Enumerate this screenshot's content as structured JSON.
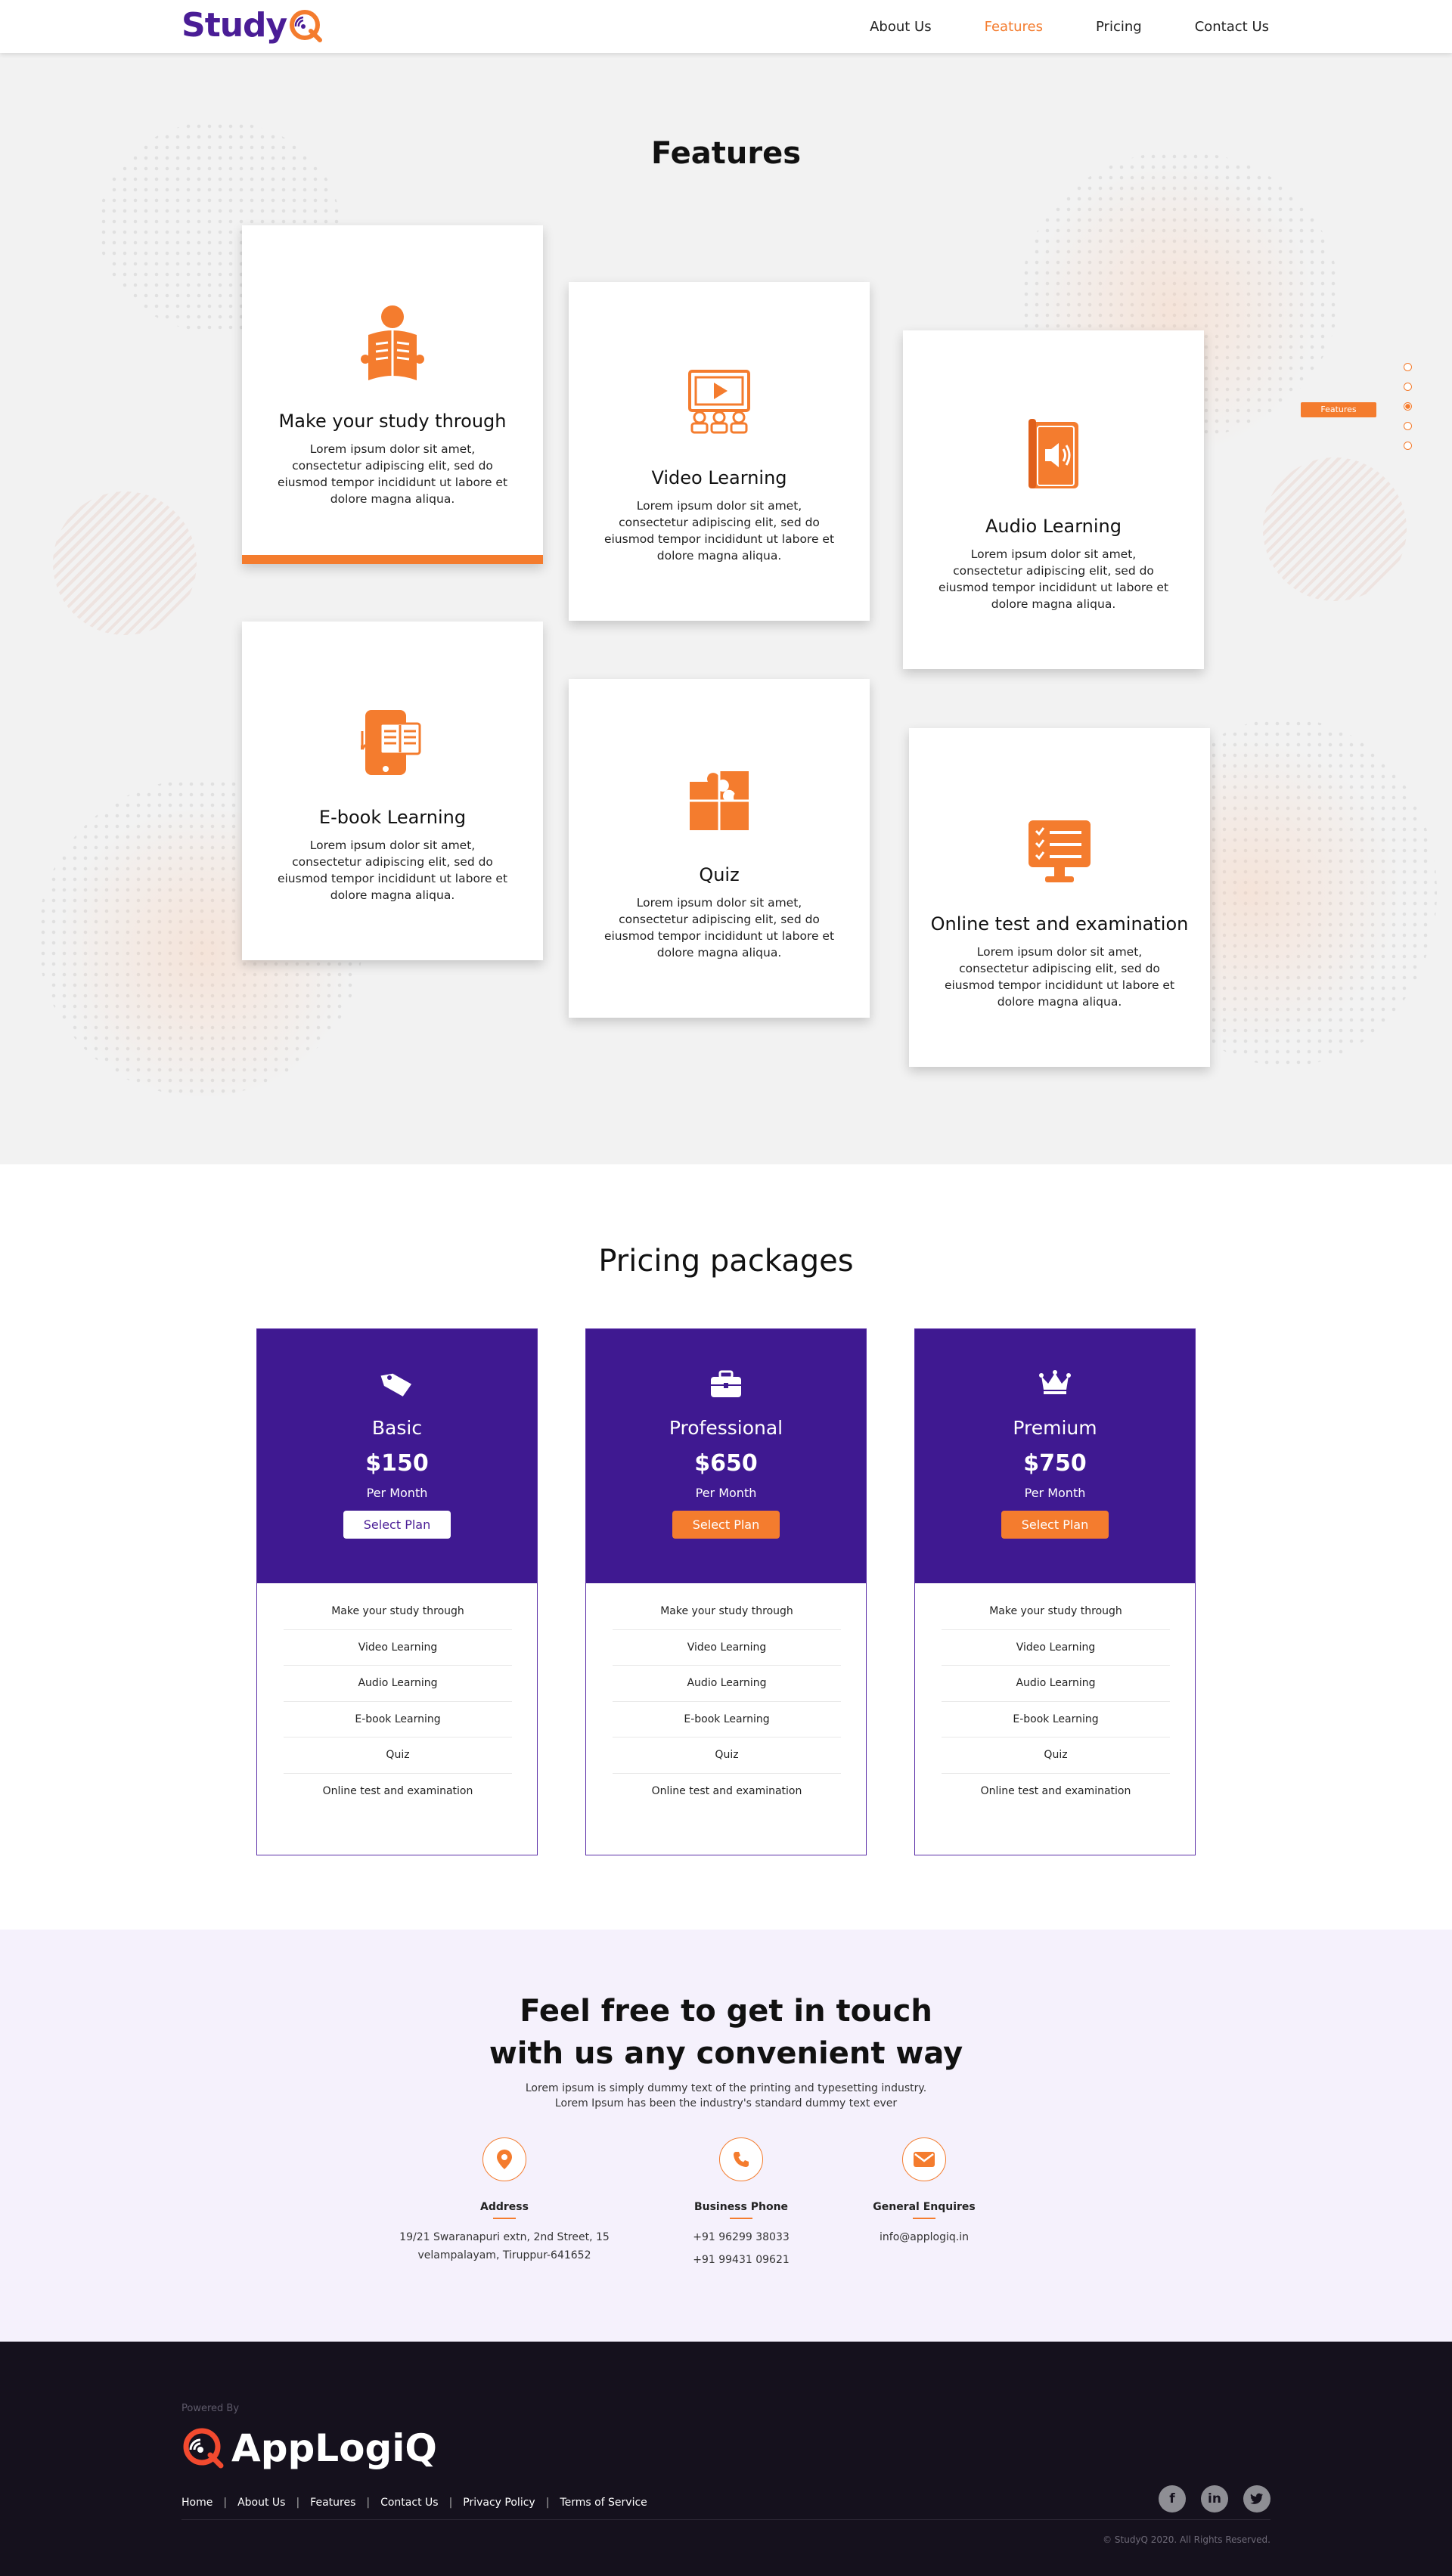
{
  "header": {
    "logo_text": "Study",
    "nav": [
      "About Us",
      "Features",
      "Pricing",
      "Contact Us"
    ],
    "active_nav": "Features"
  },
  "features": {
    "title": "Features",
    "side_nav_label": "Features",
    "cards": [
      {
        "title": "Make your study through",
        "icon": "reading-person-icon",
        "desc": "Lorem ipsum dolor sit amet, consectetur adipiscing elit, sed do eiusmod tempor incididunt ut labore et dolore magna aliqua."
      },
      {
        "title": "Video Learning",
        "icon": "video-screen-icon",
        "desc": "Lorem ipsum dolor sit amet, consectetur adipiscing elit, sed do eiusmod tempor incididunt ut labore et dolore magna aliqua."
      },
      {
        "title": "Audio Learning",
        "icon": "audio-book-icon",
        "desc": "Lorem ipsum dolor sit amet, consectetur adipiscing elit, sed do eiusmod tempor incididunt ut labore et dolore magna aliqua."
      },
      {
        "title": "E-book Learning",
        "icon": "ebook-phone-icon",
        "desc": "Lorem ipsum dolor sit amet, consectetur adipiscing elit, sed do eiusmod tempor incididunt ut labore et dolore magna aliqua."
      },
      {
        "title": "Quiz",
        "icon": "puzzle-icon",
        "desc": "Lorem ipsum dolor sit amet, consectetur adipiscing elit, sed do eiusmod tempor incididunt ut labore et dolore magna aliqua."
      },
      {
        "title": "Online test and examination",
        "icon": "checklist-monitor-icon",
        "desc": "Lorem ipsum dolor sit amet, consectetur adipiscing elit, sed do eiusmod tempor incididunt ut labore et dolore magna aliqua."
      }
    ]
  },
  "pricing": {
    "title": "Pricing packages",
    "plans": [
      {
        "name": "Basic",
        "icon": "tag-icon",
        "price": "$150",
        "per": "Per Month",
        "button": "Select Plan",
        "features": [
          "Make your study through",
          "Video Learning",
          "Audio Learning",
          "E-book Learning",
          "Quiz",
          "Online test and examination"
        ]
      },
      {
        "name": "Professional",
        "icon": "briefcase-icon",
        "price": "$650",
        "per": "Per Month",
        "button": "Select Plan",
        "features": [
          "Make your study through",
          "Video Learning",
          "Audio Learning",
          "E-book Learning",
          "Quiz",
          "Online test and examination"
        ]
      },
      {
        "name": "Premium",
        "icon": "crown-icon",
        "price": "$750",
        "per": "Per Month",
        "button": "Select Plan",
        "features": [
          "Make your study through",
          "Video Learning",
          "Audio Learning",
          "E-book Learning",
          "Quiz",
          "Online test and examination"
        ]
      }
    ]
  },
  "contact": {
    "title_line1": "Feel free to get in touch",
    "title_line2": "with us any convenient way",
    "sub_line1": "Lorem ipsum is simply dummy text of the printing and typesetting industry.",
    "sub_line2": "Lorem Ipsum has been the industry's standard dummy text ever",
    "address": {
      "label": "Address",
      "line1": "19/21 Swaranapuri extn, 2nd Street, 15",
      "line2": "velampalayam, Tiruppur-641652"
    },
    "phone": {
      "label": "Business Phone",
      "line1": "+91 96299 38033",
      "line2": "+91 99431 09621"
    },
    "email": {
      "label": "General Enquires",
      "line1": "info@applogiq.in"
    }
  },
  "footer": {
    "powered": "Powered By",
    "logo_text": "AppLogiQ",
    "links": [
      "Home",
      "About Us",
      "Features",
      "Contact Us",
      "Privacy Policy",
      "Terms of Service"
    ],
    "social": [
      "facebook-icon",
      "linkedin-icon",
      "twitter-icon"
    ],
    "copyright": "© StudyQ 2020. All Rights Reserved."
  },
  "colors": {
    "primary": "#3f1991",
    "accent": "#f47c2e",
    "features_bg": "#f2f2f2",
    "contact_bg": "#f5f1fc",
    "footer_bg": "#15111d"
  }
}
